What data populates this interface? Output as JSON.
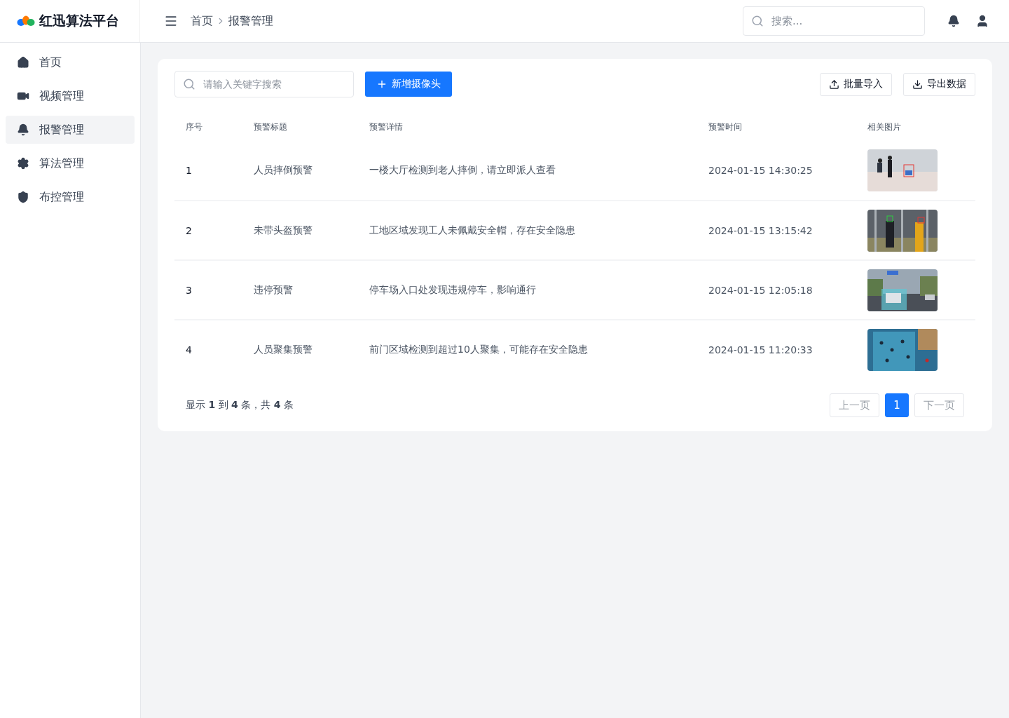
{
  "brand": {
    "name": "红迅算法平台"
  },
  "breadcrumb": [
    "首页",
    "报警管理"
  ],
  "header_search": {
    "placeholder": "搜索..."
  },
  "sidebar": {
    "items": [
      {
        "label": "首页",
        "selected": false
      },
      {
        "label": "视频管理",
        "selected": false
      },
      {
        "label": "报警管理",
        "selected": true
      },
      {
        "label": "算法管理",
        "selected": false
      },
      {
        "label": "布控管理",
        "selected": false
      }
    ]
  },
  "toolbar": {
    "search": {
      "placeholder": "请输入关键字搜索"
    },
    "add_button": "新增摄像头",
    "import_button": "批量导入",
    "export_button": "导出数据"
  },
  "table": {
    "columns": [
      "序号",
      "预警标题",
      "预警详情",
      "预警时间",
      "相关图片"
    ],
    "rows": [
      {
        "index": "1",
        "title": "人员摔倒预警",
        "detail": "一楼大厅检测到老人摔倒，请立即派人查看",
        "time": "2024-01-15 14:30:25"
      },
      {
        "index": "2",
        "title": "未带头盔预警",
        "detail": "工地区域发现工人未佩戴安全帽，存在安全隐患",
        "time": "2024-01-15 13:15:42"
      },
      {
        "index": "3",
        "title": "违停预警",
        "detail": "停车场入口处发现违规停车，影响通行",
        "time": "2024-01-15 12:05:18"
      },
      {
        "index": "4",
        "title": "人员聚集预警",
        "detail": "前门区域检测到超过10人聚集，可能存在安全隐患",
        "time": "2024-01-15 11:20:33"
      }
    ]
  },
  "footer": {
    "summary": "显示 **1** 到 **4** 条，共 **4** 条",
    "pages": [
      {
        "label": "上一页",
        "kind": "prev",
        "disabled": true,
        "selected": false
      },
      {
        "label": "1",
        "kind": "page",
        "disabled": false,
        "selected": true
      },
      {
        "label": "下一页",
        "kind": "next",
        "disabled": true,
        "selected": false
      }
    ]
  }
}
